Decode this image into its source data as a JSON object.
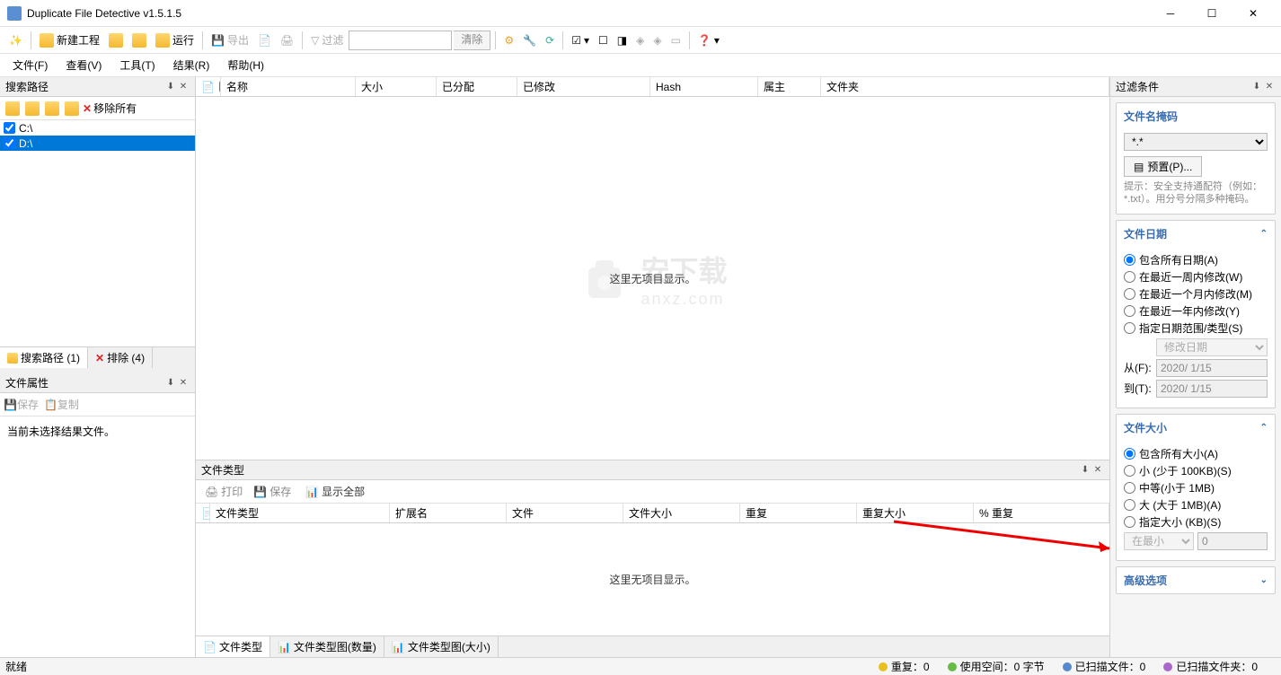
{
  "app": {
    "title": "Duplicate File Detective v1.5.1.5"
  },
  "toolbar": {
    "new_project": "新建工程",
    "run": "运行",
    "export": "导出",
    "filter": "过滤",
    "clear": "清除"
  },
  "menu": {
    "file": "文件(F)",
    "view": "查看(V)",
    "tools": "工具(T)",
    "results": "结果(R)",
    "help": "帮助(H)"
  },
  "left": {
    "search_path_title": "搜索路径",
    "remove_all": "移除所有",
    "drives": [
      "C:\\",
      "D:\\"
    ],
    "tab_search": "搜索路径 (1)",
    "tab_exclude": "排除 (4)",
    "props_title": "文件属性",
    "save": "保存",
    "copy": "复制",
    "props_msg": "当前未选择结果文件。"
  },
  "centerGrid": {
    "cols": [
      "名称",
      "大小",
      "已分配",
      "已修改",
      "Hash",
      "属主",
      "文件夹"
    ],
    "empty": "这里无项目显示。"
  },
  "bottom": {
    "title": "文件类型",
    "print": "打印",
    "save": "保存",
    "show_all": "显示全部",
    "cols": [
      "文件类型",
      "扩展名",
      "文件",
      "文件大小",
      "重复",
      "重复大小",
      "% 重复"
    ],
    "empty": "这里无项目显示。",
    "tabs": [
      "文件类型",
      "文件类型图(数量)",
      "文件类型图(大小)"
    ]
  },
  "right": {
    "title": "过滤条件",
    "mask": {
      "title": "文件名掩码",
      "value": "*.*",
      "preset": "预置(P)...",
      "hint": "提示：安全支持通配符（例如：*.txt）。用分号分隔多种掩码。"
    },
    "date": {
      "title": "文件日期",
      "opts": [
        "包含所有日期(A)",
        "在最近一周内修改(W)",
        "在最近一个月内修改(M)",
        "在最近一年内修改(Y)",
        "指定日期范围/类型(S)"
      ],
      "modify_type": "修改日期",
      "from_label": "从(F):",
      "to_label": "到(T):",
      "from": "2020/ 1/15",
      "to": "2020/ 1/15"
    },
    "size": {
      "title": "文件大小",
      "opts": [
        "包含所有大小(A)",
        "小 (少于 100KB)(S)",
        "中等(小于 1MB)",
        "大 (大于 1MB)(A)",
        "指定大小 (KB)(S)"
      ],
      "min_label": "在最小",
      "min_value": "0"
    },
    "advanced": "高级选项"
  },
  "status": {
    "ready": "就绪",
    "dup": "重复：0",
    "used": "使用空间：0 字节",
    "scanned_files": "已扫描文件：0",
    "scanned_folders": "已扫描文件夹：0"
  },
  "watermark": {
    "text": "安下载",
    "url": "anxz.com"
  }
}
